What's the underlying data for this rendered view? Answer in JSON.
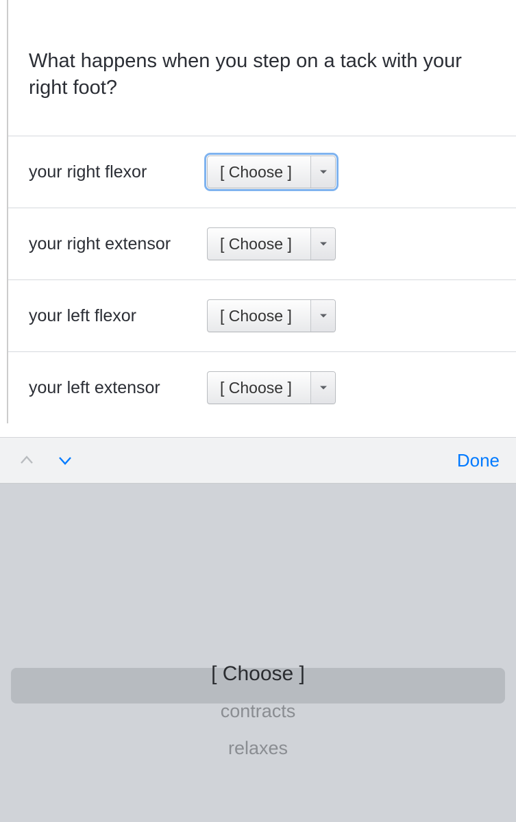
{
  "question": "What happens when you step on a tack with your right foot?",
  "rows": [
    {
      "label": "your right flexor",
      "value": "[ Choose ]",
      "focused": true
    },
    {
      "label": "your right extensor",
      "value": "[ Choose ]",
      "focused": false
    },
    {
      "label": "your left flexor",
      "value": "[ Choose ]",
      "focused": false
    },
    {
      "label": "your left extensor",
      "value": "[ Choose ]",
      "focused": false
    }
  ],
  "accessory": {
    "done": "Done"
  },
  "picker": {
    "options": [
      "[ Choose ]",
      "contracts",
      "relaxes"
    ],
    "selected_index": 0
  }
}
